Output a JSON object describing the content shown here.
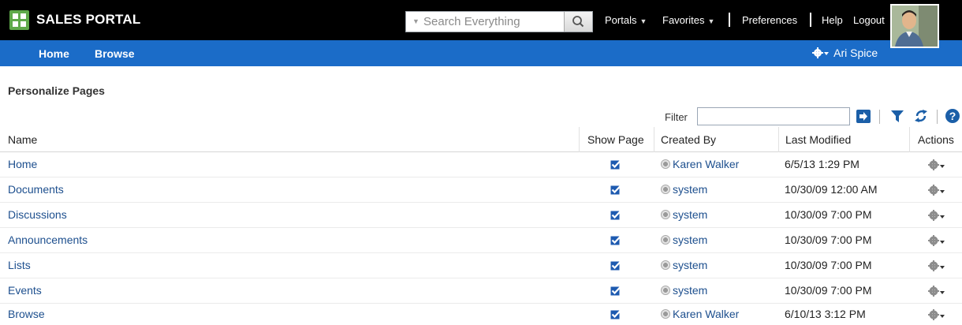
{
  "header": {
    "app_title": "SALES PORTAL",
    "search_placeholder": "Search Everything",
    "nav": {
      "portals": "Portals",
      "favorites": "Favorites",
      "preferences": "Preferences",
      "help": "Help",
      "logout": "Logout"
    }
  },
  "navbar": {
    "home": "Home",
    "browse": "Browse",
    "user_name": "Ari Spice"
  },
  "page": {
    "title": "Personalize Pages",
    "filter_label": "Filter",
    "filter_value": ""
  },
  "table": {
    "columns": {
      "name": "Name",
      "show_page": "Show Page",
      "created_by": "Created By",
      "last_modified": "Last Modified",
      "actions": "Actions"
    },
    "rows": [
      {
        "name": "Home",
        "show_page": true,
        "created_by": "Karen Walker",
        "last_modified": "6/5/13 1:29 PM"
      },
      {
        "name": "Documents",
        "show_page": true,
        "created_by": "system",
        "last_modified": "10/30/09 12:00 AM"
      },
      {
        "name": "Discussions",
        "show_page": true,
        "created_by": "system",
        "last_modified": "10/30/09 7:00 PM"
      },
      {
        "name": "Announcements",
        "show_page": true,
        "created_by": "system",
        "last_modified": "10/30/09 7:00 PM"
      },
      {
        "name": "Lists",
        "show_page": true,
        "created_by": "system",
        "last_modified": "10/30/09 7:00 PM"
      },
      {
        "name": "Events",
        "show_page": true,
        "created_by": "system",
        "last_modified": "10/30/09 7:00 PM"
      },
      {
        "name": "Browse",
        "show_page": true,
        "created_by": "Karen Walker",
        "last_modified": "6/10/13 3:12 PM"
      }
    ]
  },
  "colors": {
    "topbar": "#000000",
    "navbar": "#1b6cc8",
    "logo": "#5fa94a",
    "link": "#1d4f8e"
  },
  "icons": {
    "logo": "grid-logo-icon",
    "search": "magnifier-icon",
    "settings": "gear-icon",
    "go": "arrow-right-icon",
    "filter": "funnel-icon",
    "refresh": "refresh-icon",
    "help": "help-icon",
    "show_page": "checkbox-checked-icon",
    "user": "user-status-icon",
    "actions": "gear-dropdown-icon"
  }
}
